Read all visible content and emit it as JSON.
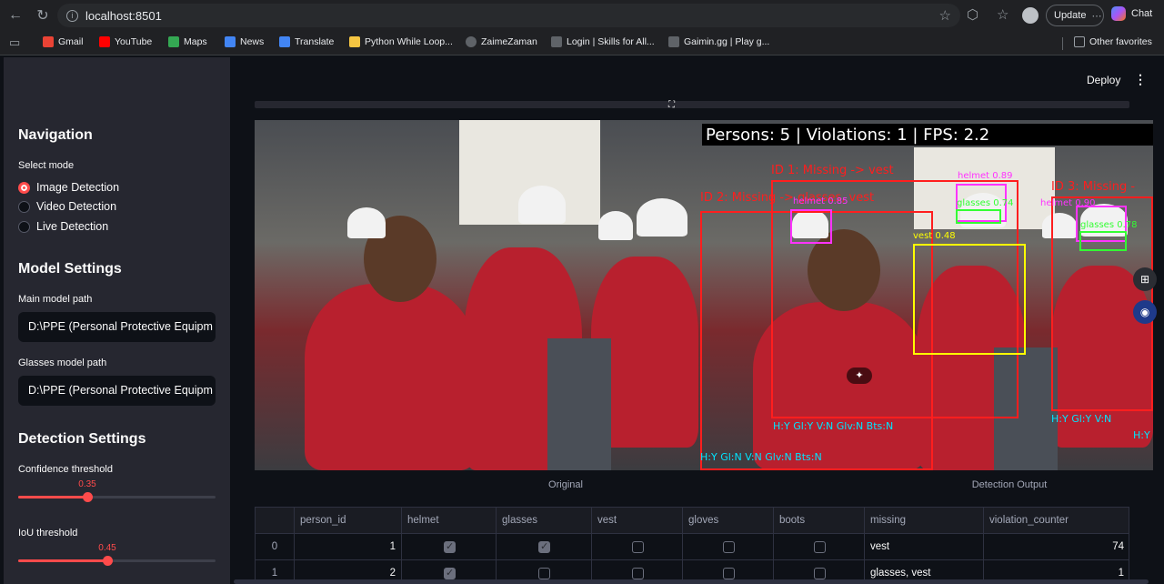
{
  "browser": {
    "url": "localhost:8501",
    "update_label": "Update",
    "chat_label": "Chat",
    "bookmarks": [
      {
        "label": "Gmail",
        "color": "#ea4335"
      },
      {
        "label": "YouTube",
        "color": "#ff0000"
      },
      {
        "label": "Maps",
        "color": "#34a853"
      },
      {
        "label": "News",
        "color": "#4285f4"
      },
      {
        "label": "Translate",
        "color": "#4285f4"
      },
      {
        "label": "Python While Loop...",
        "color": "#f5c542"
      },
      {
        "label": "ZaimeZaman",
        "color": "#5f6368"
      },
      {
        "label": "Login | Skills for All...",
        "color": "#5f6368"
      },
      {
        "label": "Gaimin.gg | Play g...",
        "color": "#5f6368"
      }
    ],
    "other_favorites": "Other favorites"
  },
  "sidebar": {
    "navigation_title": "Navigation",
    "select_mode_label": "Select mode",
    "modes": [
      "Image Detection",
      "Video Detection",
      "Live Detection"
    ],
    "selected_mode": "Image Detection",
    "model_settings_title": "Model Settings",
    "main_model_label": "Main model path",
    "main_model_value": "D:\\PPE (Personal Protective Equipm",
    "glasses_model_label": "Glasses model path",
    "glasses_model_value": "D:\\PPE (Personal Protective Equipm",
    "detection_settings_title": "Detection Settings",
    "confidence_label": "Confidence threshold",
    "confidence_value": "0.35",
    "confidence_fraction": 0.35,
    "iou_label": "IoU threshold",
    "iou_value": "0.45",
    "iou_fraction": 0.45
  },
  "header": {
    "deploy_label": "Deploy"
  },
  "output_image": {
    "stats": "Persons: 5 | Violations: 1 | FPS: 2.2",
    "labels": {
      "id1": "ID 1: Missing -> vest",
      "id2": "ID 2: Missing -> glasses, vest",
      "id3": "ID 3: Missing -",
      "helmet1": "helmet 0.89",
      "glasses1": "glasses 0.74",
      "vest1": "vest 0.48",
      "helmet2": "helmet 0.90",
      "glasses2": "glasses 0.78",
      "helmet3": "helmet 0.85"
    },
    "flags": {
      "a": "H:Y   Gl:Y   V:N   Glv:N   Bts:N",
      "b": "H:Y   Gl:N   V:N   Glv:N   Bts:N",
      "c": "H:Y   Gl:Y   V:N",
      "d": "H:Y"
    }
  },
  "captions": {
    "original": "Original",
    "output": "Detection Output"
  },
  "table": {
    "columns": [
      "",
      "person_id",
      "helmet",
      "glasses",
      "vest",
      "gloves",
      "boots",
      "missing",
      "violation_counter"
    ],
    "rows": [
      {
        "index": "0",
        "person_id": "1",
        "helmet": true,
        "glasses": true,
        "vest": false,
        "gloves": false,
        "boots": false,
        "missing": "vest",
        "violation_counter": "74"
      },
      {
        "index": "1",
        "person_id": "2",
        "helmet": true,
        "glasses": false,
        "vest": false,
        "gloves": false,
        "boots": false,
        "missing": "glasses, vest",
        "violation_counter": "1"
      }
    ]
  },
  "colors": {
    "accent": "#ff4b4b",
    "sidebar_bg": "#262730",
    "main_bg": "#0e1117",
    "box_red": "#ff1e1e",
    "box_magenta": "#ff33ff",
    "box_green": "#33ff33",
    "box_yellow": "#ffff00",
    "flag_cyan": "#00e5ff"
  }
}
